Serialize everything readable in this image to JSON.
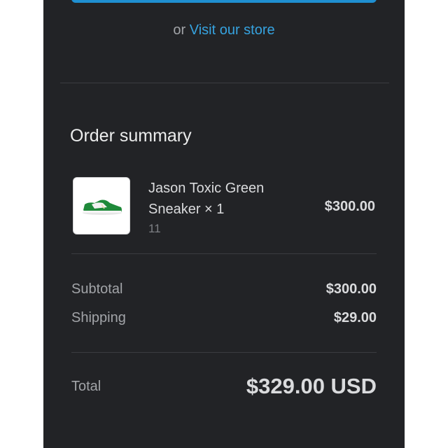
{
  "store_link": {
    "prefix": "or",
    "link_label": "Visit our store"
  },
  "order_summary": {
    "title": "Order summary",
    "item": {
      "image_icon": "green-sneaker-image",
      "name": "Jason Toxic Green Sneaker × 1",
      "variant": "11",
      "price": "$300.00"
    },
    "subtotal_label": "Subtotal",
    "subtotal_value": "$300.00",
    "shipping_label": "Shipping",
    "shipping_value": "$29.00",
    "total_label": "Total",
    "total_value": "$329.00 USD"
  },
  "colors": {
    "panel_background": "#222326",
    "link": "#36a3e0",
    "primary_button": "#1f8fd1"
  }
}
